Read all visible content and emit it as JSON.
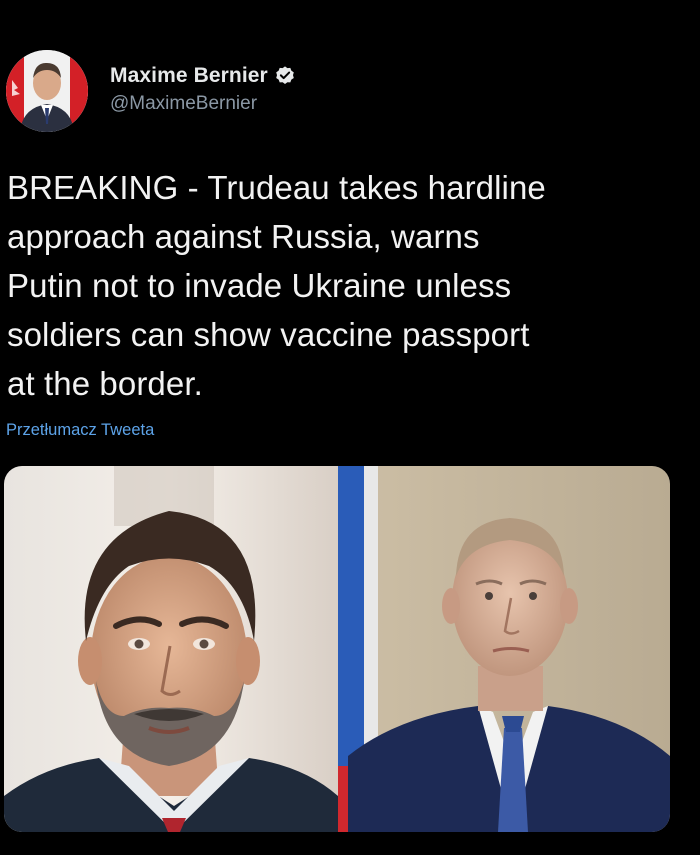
{
  "author": {
    "display_name": "Maxime Bernier",
    "handle": "@MaximeBernier",
    "verified": true,
    "avatar_icon": "profile-photo"
  },
  "tweet": {
    "text": "BREAKING - Trudeau takes hardline\napproach against Russia, warns\nPutin not to invade Ukraine unless\nsoldiers can show vaccine passport\nat the border.",
    "translate_link": "Przetłumacz Tweeta"
  },
  "media": {
    "photos": [
      {
        "name": "left-photo",
        "icon": "portrait-man-bearded"
      },
      {
        "name": "right-photo",
        "icon": "portrait-man-suit-flag"
      }
    ]
  },
  "colors": {
    "background": "#000000",
    "link": "#5da3e8",
    "verified_badge": "#e7e9ea",
    "handle": "#8b98a5"
  }
}
